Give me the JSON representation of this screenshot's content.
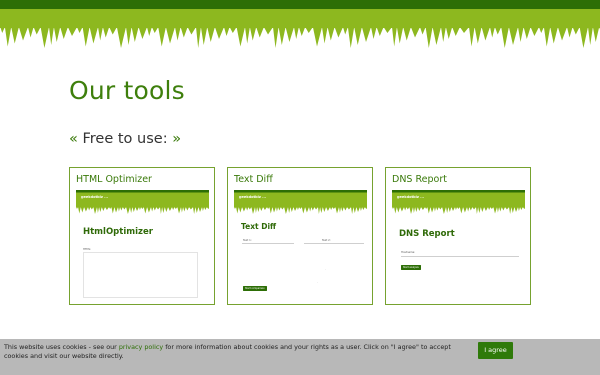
{
  "header": {
    "brand_dark": "#2d6e06",
    "brand_grass": "#8db81f"
  },
  "page": {
    "title": "Our tools",
    "section_prefix": "« ",
    "section_label": "Free to use:",
    "section_suffix": " »"
  },
  "tools": [
    {
      "title": "HTML Optimizer",
      "thumb_logo": "geekdotbiz ...",
      "thumb_heading": "HtmlOptimizer",
      "thumb_field": "HTML:"
    },
    {
      "title": "Text Diff",
      "thumb_logo": "geekdotbiz ...",
      "thumb_heading": "Text Diff",
      "thumb_field_a": "Text 1:",
      "thumb_field_b": "Text 2:",
      "thumb_button": "Start comparison"
    },
    {
      "title": "DNS Report",
      "thumb_logo": "geekdotbiz ...",
      "thumb_heading": "DNS Report",
      "thumb_field": "Hostname:",
      "thumb_button": "Start analysis"
    }
  ],
  "cookie": {
    "text_before": "This website uses cookies - see our ",
    "link": "privacy policy",
    "text_after": " for more information about cookies and your rights as a user. Click on \"I agree\" to accept cookies and visit our website directly.",
    "button": "I agree"
  }
}
